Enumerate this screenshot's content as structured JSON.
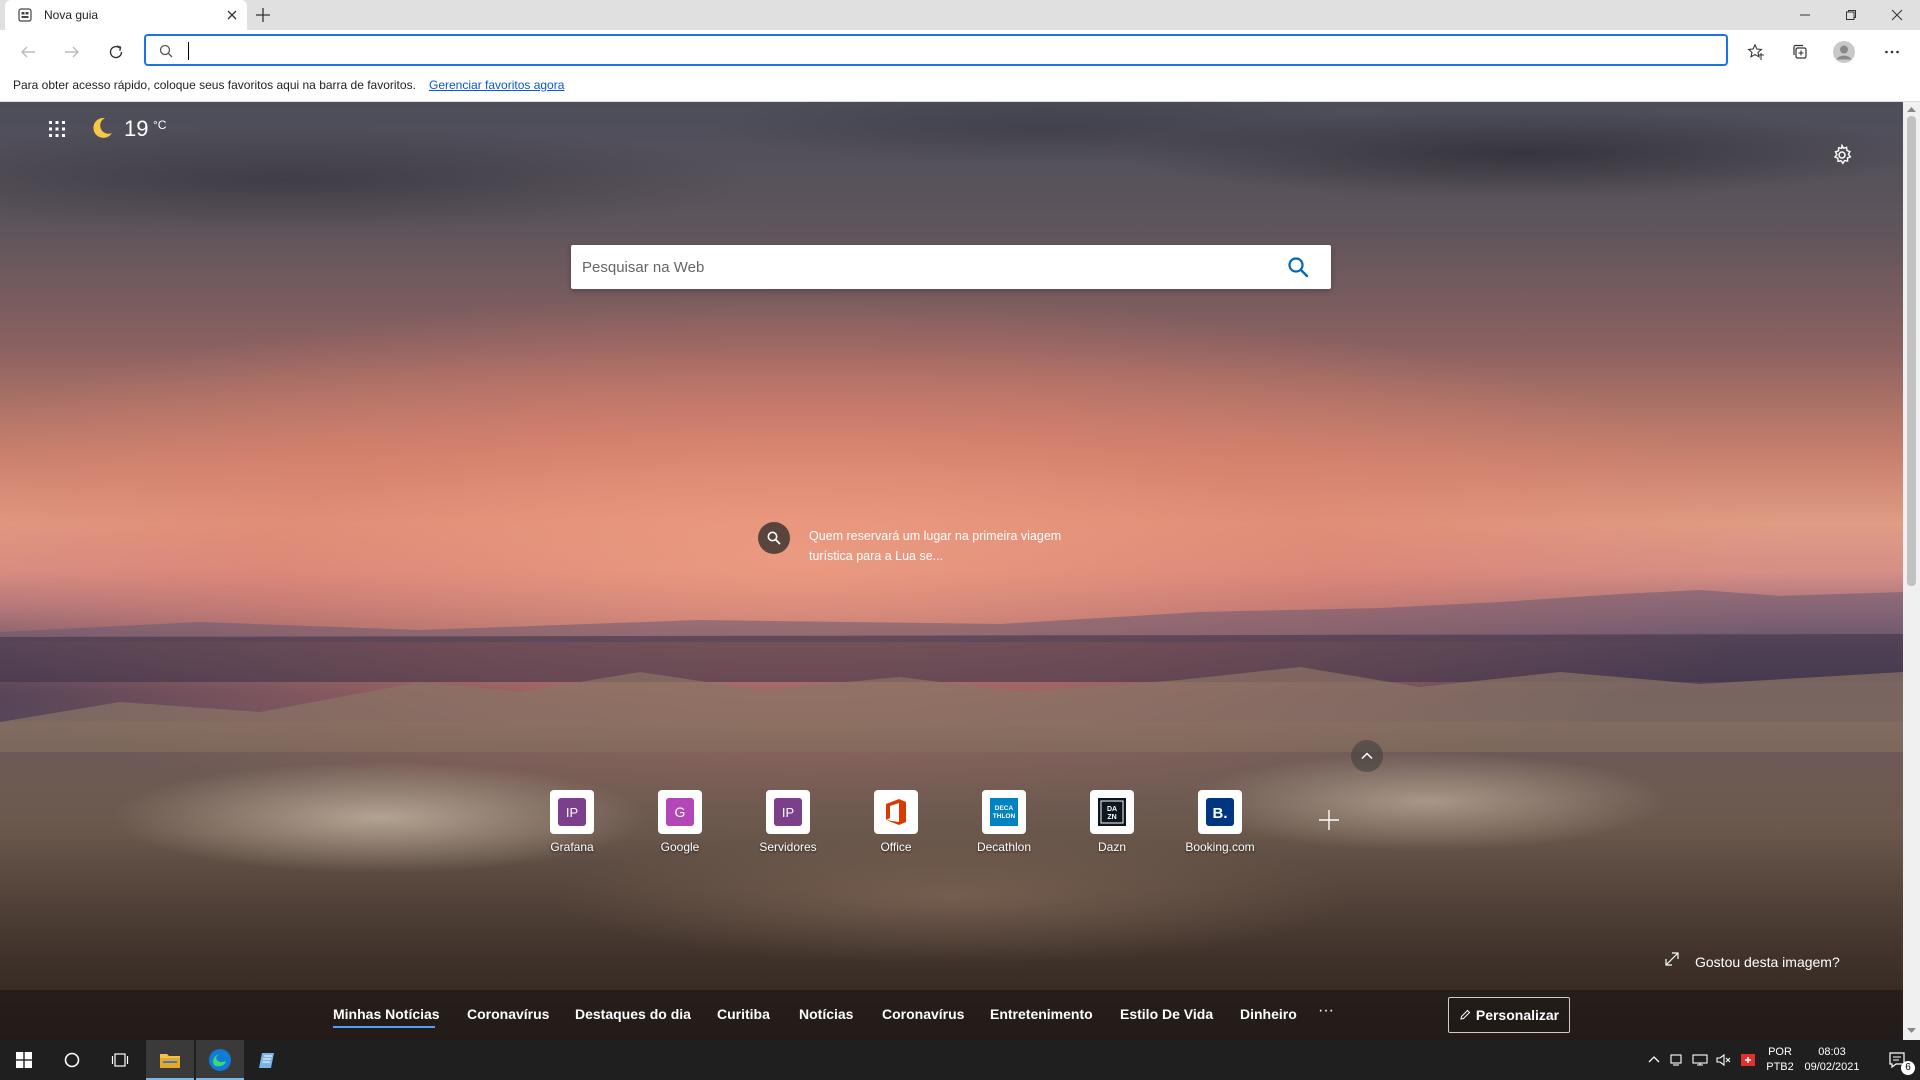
{
  "tab": {
    "title": "Nova guia"
  },
  "address_bar": {
    "value": "",
    "placeholder": ""
  },
  "favorites_bar": {
    "message": "Para obter acesso rápido, coloque seus favoritos aqui na barra de favoritos.",
    "link": "Gerenciar favoritos agora"
  },
  "weather": {
    "temp": "19",
    "unit": "°C",
    "icon": "moon-icon"
  },
  "search": {
    "placeholder": "Pesquisar na Web"
  },
  "hint": {
    "text": "Quem reservará um lugar na primeira viagem turística para a Lua se..."
  },
  "quick_links": [
    {
      "label": "Grafana",
      "icon_text": "IP",
      "color": "#7b3f8c"
    },
    {
      "label": "Google",
      "icon_text": "G",
      "color": "#b447b8"
    },
    {
      "label": "Servidores",
      "icon_text": "IP",
      "color": "#7b3f8c"
    },
    {
      "label": "Office",
      "icon_text": "",
      "color": "#d83b01"
    },
    {
      "label": "Decathlon",
      "icon_text": "DECATHLON",
      "color": "#0082c3"
    },
    {
      "label": "Dazn",
      "icon_text": "DA ZN",
      "color": "#0c161c"
    },
    {
      "label": "Booking.com",
      "icon_text": "B.",
      "color": "#003580"
    }
  ],
  "image_feedback": {
    "text": "Gostou desta imagem?"
  },
  "news_tabs": [
    {
      "label": "Minhas Notícias",
      "active": true
    },
    {
      "label": "Coronavírus"
    },
    {
      "label": "Destaques do dia"
    },
    {
      "label": "Curitiba"
    },
    {
      "label": "Notícias"
    },
    {
      "label": "Coronavírus"
    },
    {
      "label": "Entretenimento"
    },
    {
      "label": "Estilo De Vida"
    },
    {
      "label": "Dinheiro"
    }
  ],
  "news_more": "···",
  "personalize": {
    "label": "Personalizar"
  },
  "taskbar": {
    "lang_top": "POR",
    "lang_bottom": "PTB2",
    "time": "08:03",
    "date": "09/02/2021",
    "notif_count": "6"
  },
  "colors": {
    "accent": "#1a73e8",
    "news_active": "#4da3ff"
  }
}
